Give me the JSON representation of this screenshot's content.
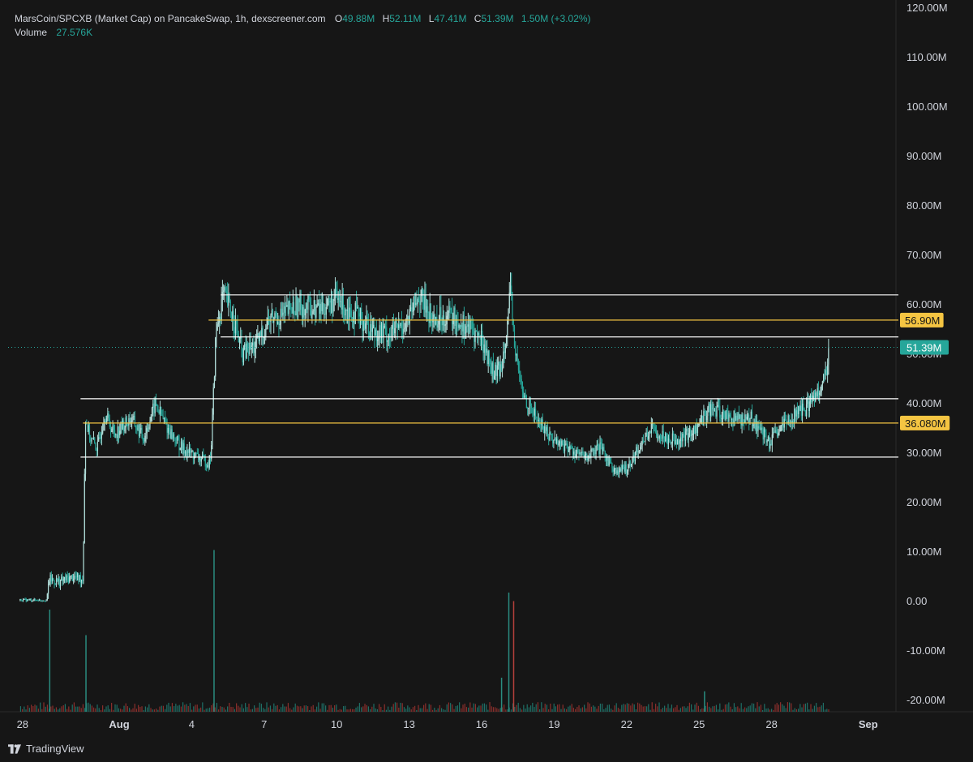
{
  "header": {
    "title": "MarsCoin/SPCXB (Market Cap) on PancakeSwap, 1h, dexscreener.com",
    "open_label": "O",
    "open": "49.88M",
    "high_label": "H",
    "high": "52.11M",
    "low_label": "L",
    "low": "47.41M",
    "close_label": "C",
    "close": "51.39M",
    "change": "1.50M (+3.02%)",
    "volume_label": "Volume",
    "volume": "27.576K"
  },
  "branding": {
    "name": "TradingView"
  },
  "colors": {
    "background": "#161616",
    "up": "#26a69a",
    "down": "#ef5350",
    "candle_up": "#b2dfdb",
    "level_white": "#ffffff",
    "level_yellow": "#f5c542",
    "last_price": "#26a69a"
  },
  "chart_data": {
    "type": "candlestick",
    "ylim": [
      -22,
      120
    ],
    "y_ticks": [
      "120.00M",
      "110.00M",
      "100.00M",
      "90.00M",
      "80.00M",
      "70.00M",
      "60.00M",
      "50.00M",
      "40.00M",
      "30.00M",
      "20.00M",
      "10.00M",
      "0.00",
      "-10.00M",
      "-20.00M"
    ],
    "y_tick_values": [
      120,
      110,
      100,
      90,
      80,
      70,
      60,
      50,
      40,
      30,
      20,
      10,
      0,
      -10,
      -20
    ],
    "x_ticks": [
      "28",
      "Aug",
      "4",
      "7",
      "10",
      "13",
      "16",
      "19",
      "22",
      "25",
      "28",
      "Sep"
    ],
    "x_tick_days": [
      -4,
      0,
      3,
      6,
      9,
      12,
      15,
      18,
      21,
      24,
      27,
      31
    ],
    "x_range_days": [
      -4.4,
      31.2
    ],
    "price_path": [
      [
        -4.1,
        0.3
      ],
      [
        -3.0,
        0.3
      ],
      [
        -2.9,
        4.5
      ],
      [
        -2.5,
        4.0
      ],
      [
        -1.9,
        5.0
      ],
      [
        -1.5,
        4.5
      ],
      [
        -1.4,
        37
      ],
      [
        -1.2,
        33
      ],
      [
        -0.9,
        31
      ],
      [
        -0.6,
        38
      ],
      [
        -0.2,
        34
      ],
      [
        0.5,
        37
      ],
      [
        1.0,
        33
      ],
      [
        1.5,
        40
      ],
      [
        2.0,
        35
      ],
      [
        2.6,
        31
      ],
      [
        3.3,
        29
      ],
      [
        3.7,
        28
      ],
      [
        3.8,
        30
      ],
      [
        4.0,
        54
      ],
      [
        4.3,
        62
      ],
      [
        4.7,
        58
      ],
      [
        5.1,
        50
      ],
      [
        5.7,
        52
      ],
      [
        6.2,
        57
      ],
      [
        6.8,
        58
      ],
      [
        7.4,
        60
      ],
      [
        8.2,
        59
      ],
      [
        9.0,
        61
      ],
      [
        9.8,
        58
      ],
      [
        10.5,
        55
      ],
      [
        11.2,
        54
      ],
      [
        12.0,
        57
      ],
      [
        12.4,
        62
      ],
      [
        13.0,
        57
      ],
      [
        13.6,
        58
      ],
      [
        14.3,
        56
      ],
      [
        15.0,
        53
      ],
      [
        15.5,
        46
      ],
      [
        15.8,
        47
      ],
      [
        16.2,
        62
      ],
      [
        16.4,
        50
      ],
      [
        16.7,
        42
      ],
      [
        17.3,
        37
      ],
      [
        17.9,
        33
      ],
      [
        18.6,
        31
      ],
      [
        19.3,
        29
      ],
      [
        19.9,
        31
      ],
      [
        20.6,
        26
      ],
      [
        21.0,
        27
      ],
      [
        21.5,
        31
      ],
      [
        22.0,
        35
      ],
      [
        22.7,
        33
      ],
      [
        23.3,
        33
      ],
      [
        23.9,
        35
      ],
      [
        24.4,
        39
      ],
      [
        24.9,
        38
      ],
      [
        25.5,
        37
      ],
      [
        26.2,
        37
      ],
      [
        26.9,
        32
      ],
      [
        27.4,
        35
      ],
      [
        28.0,
        38
      ],
      [
        28.4,
        39
      ],
      [
        28.7,
        41
      ],
      [
        29.2,
        45
      ],
      [
        29.4,
        51.4
      ]
    ],
    "last_price": 51.39,
    "last_price_label": "51.39M",
    "levels": [
      {
        "value": 62,
        "color": "white",
        "from_day": 4.2
      },
      {
        "value": 56.9,
        "color": "yellow",
        "label": "56.90M",
        "from_day": 3.7
      },
      {
        "value": 53.5,
        "color": "white",
        "from_day": 4.2
      },
      {
        "value": 41,
        "color": "white",
        "from_day": -1.6
      },
      {
        "value": 36.08,
        "color": "yellow",
        "label": "36.080M",
        "from_day": -1.5
      },
      {
        "value": 29.2,
        "color": "white",
        "from_day": -1.6
      }
    ],
    "volume_spikes": [
      {
        "day": -2.9,
        "value": 60,
        "color": "up"
      },
      {
        "day": -1.4,
        "value": 45,
        "color": "up"
      },
      {
        "day": 3.9,
        "value": 95,
        "color": "up"
      },
      {
        "day": 16.1,
        "value": 70,
        "color": "up"
      },
      {
        "day": 16.3,
        "value": 65,
        "color": "down"
      },
      {
        "day": 15.8,
        "value": 20,
        "color": "up"
      },
      {
        "day": 24.2,
        "value": 12,
        "color": "up"
      }
    ]
  }
}
